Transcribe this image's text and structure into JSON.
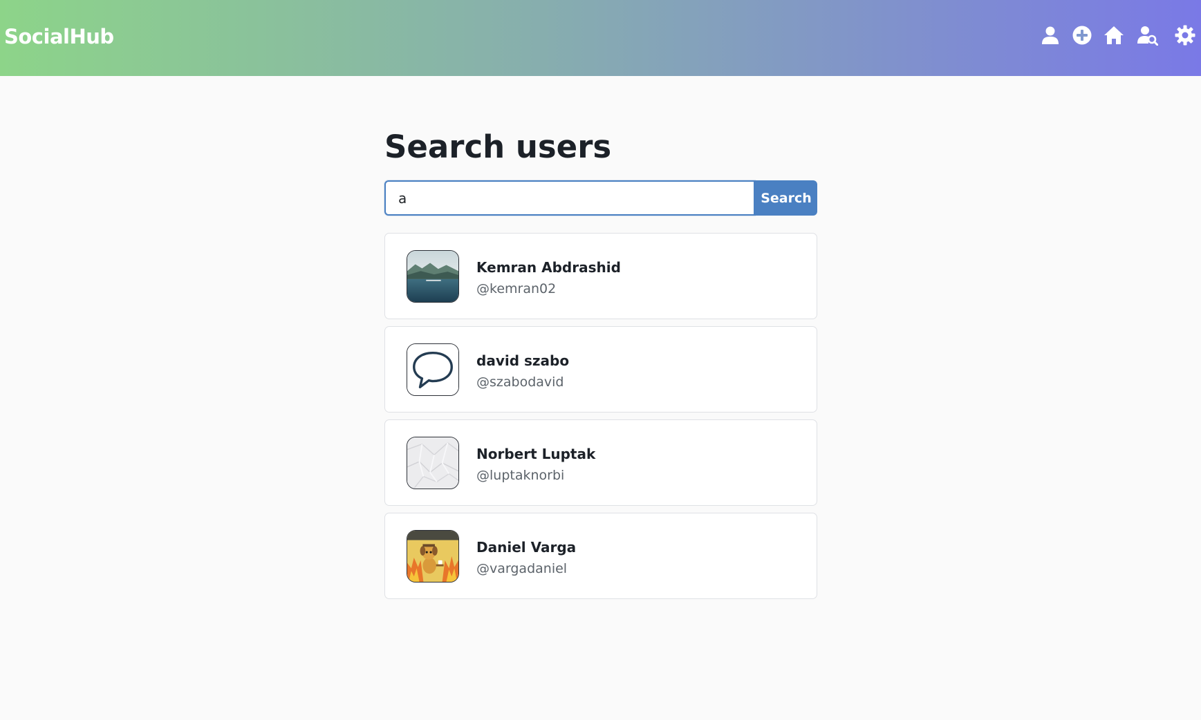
{
  "app": {
    "brand": "SocialHub"
  },
  "nav": {
    "icons": [
      "user-icon",
      "plus-circle-icon",
      "home-icon",
      "user-search-icon",
      "gear-icon"
    ]
  },
  "colors": {
    "accent": "#4a80c2",
    "nav_gradient_start": "#8dd489",
    "nav_gradient_end": "#7a79e6"
  },
  "page": {
    "title": "Search users",
    "search": {
      "value": "a",
      "button_label": "Search"
    }
  },
  "results": [
    {
      "name": "Kemran Abdrashid",
      "handle": "@kemran02",
      "avatar": "lake-landscape-avatar"
    },
    {
      "name": "david szabo",
      "handle": "@szabodavid",
      "avatar": "speech-bubble-avatar"
    },
    {
      "name": "Norbert Luptak",
      "handle": "@luptaknorbi",
      "avatar": "crumpled-paper-avatar"
    },
    {
      "name": "Daniel Varga",
      "handle": "@vargadaniel",
      "avatar": "this-is-fine-dog-avatar"
    }
  ]
}
